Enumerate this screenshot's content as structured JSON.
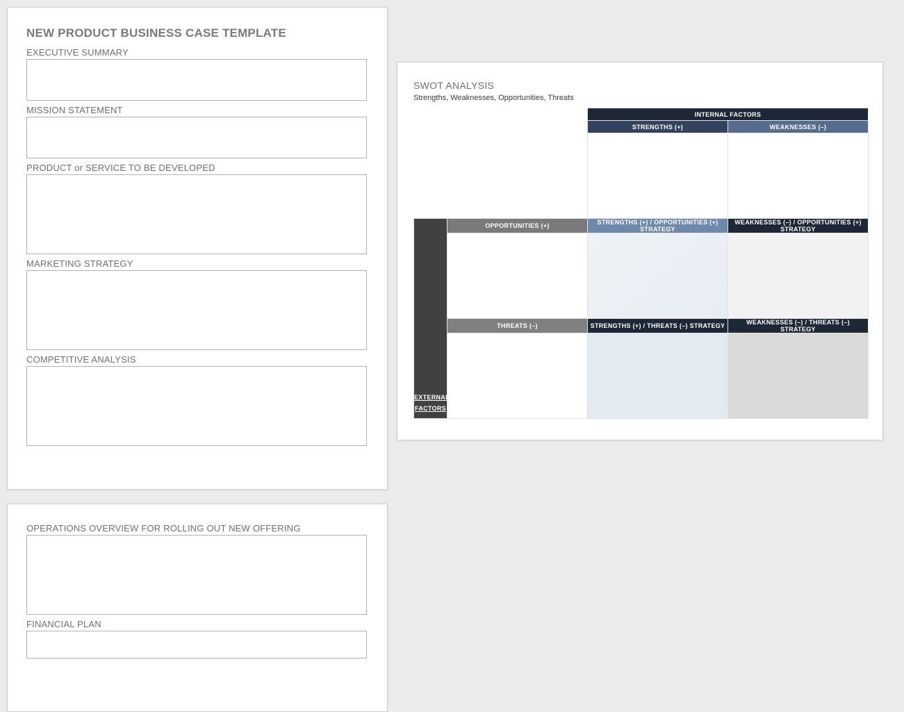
{
  "doc": {
    "title": "NEW PRODUCT BUSINESS CASE TEMPLATE"
  },
  "sections": {
    "executive_summary": "EXECUTIVE SUMMARY",
    "mission_statement": "MISSION STATEMENT",
    "product_service": "PRODUCT or SERVICE TO BE DEVELOPED",
    "marketing_strategy": "MARKETING STRATEGY",
    "competitive_analysis": "COMPETITIVE ANALYSIS",
    "operations_overview": "OPERATIONS OVERVIEW FOR ROLLING OUT NEW OFFERING",
    "financial_plan": "FINANCIAL PLAN"
  },
  "values": {
    "executive_summary": "",
    "mission_statement": "",
    "product_service": "",
    "marketing_strategy": "",
    "competitive_analysis": "",
    "operations_overview": "",
    "financial_plan": ""
  },
  "swot": {
    "heading": "SWOT ANALYSIS",
    "subtitle": "Strengths, Weaknesses, Opportunities, Threats",
    "internal_factors": "INTERNAL   FACTORS",
    "external_factors_line1": "EXTERNAL",
    "external_factors_line2": "FACTORS",
    "strengths": "STRENGTHS (+)",
    "weaknesses": "WEAKNESSES (–)",
    "opportunities": "OPPORTUNITIES (+)",
    "threats": "THREATS (–)",
    "so_strategy": "STRENGTHS (+) / OPPORTUNITIES (+) STRATEGY",
    "wo_strategy": "WEAKNESSES (–) / OPPORTUNITIES (+) STRATEGY",
    "st_strategy": "STRENGTHS (+) / THREATS (–) STRATEGY",
    "wt_strategy": "WEAKNESSES (–) / THREATS (–) STRATEGY"
  }
}
